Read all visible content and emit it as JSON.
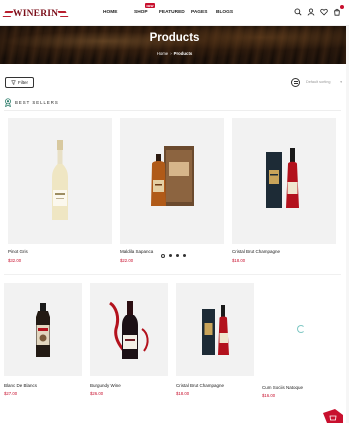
{
  "brand": {
    "logo_text": "WINERIN"
  },
  "nav": {
    "items": [
      {
        "label": "HOME"
      },
      {
        "label": "SHOP",
        "badge": "NEW"
      },
      {
        "label": "FEATURED"
      },
      {
        "label": "PAGES"
      },
      {
        "label": "BLOGS"
      }
    ]
  },
  "header_icons": [
    "search-icon",
    "user-icon",
    "heart-icon",
    "cart-icon"
  ],
  "banner": {
    "title": "Products",
    "breadcrumb": [
      "Home",
      "Products"
    ]
  },
  "toolbar": {
    "filter_label": "Filter",
    "sort_placeholder": "Default sorting"
  },
  "section": {
    "title": "BEST SELLERS"
  },
  "best_sellers": [
    {
      "name": "Pinot Gris",
      "price": "$32.00"
    },
    {
      "name": "Maldila Sapanca",
      "price": "$22.00"
    },
    {
      "name": "Cristal Brut Champagne",
      "price": "$18.00"
    }
  ],
  "carousel": {
    "dots": 4,
    "active_index": 0
  },
  "products": [
    {
      "name": "Blanc De Blancs",
      "price": "$27.00"
    },
    {
      "name": "Burgundy Wine",
      "price": "$26.00"
    },
    {
      "name": "Cristal Brut Champagne",
      "price": "$18.00"
    },
    {
      "name": "Cum Sociis Natoque",
      "price": "$16.00"
    }
  ],
  "colors": {
    "accent": "#c8102e",
    "logo": "#7a0d18",
    "card_bg": "#f2f2f2"
  }
}
